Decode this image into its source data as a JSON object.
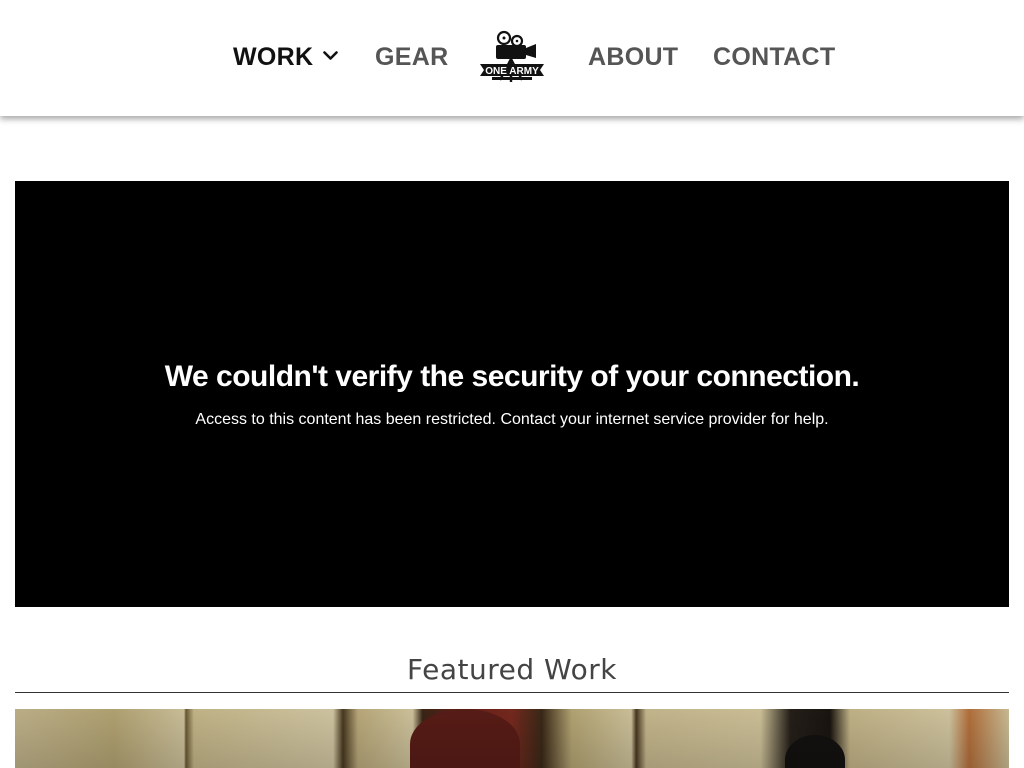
{
  "header": {
    "nav": {
      "work": "WORK",
      "gear": "GEAR",
      "about": "ABOUT",
      "contact": "CONTACT"
    },
    "logo": {
      "text": "ONE ARMY",
      "icon": "film-camera-logo"
    }
  },
  "media": {
    "title": "We couldn't verify the security of your connection.",
    "message": "Access to this content has been restricted. Contact your internet service provider for help."
  },
  "featured": {
    "heading": "Featured Work"
  },
  "colors": {
    "nav_active": "#111111",
    "nav_text": "#555555",
    "media_bg": "#000000",
    "heading": "#444444"
  }
}
